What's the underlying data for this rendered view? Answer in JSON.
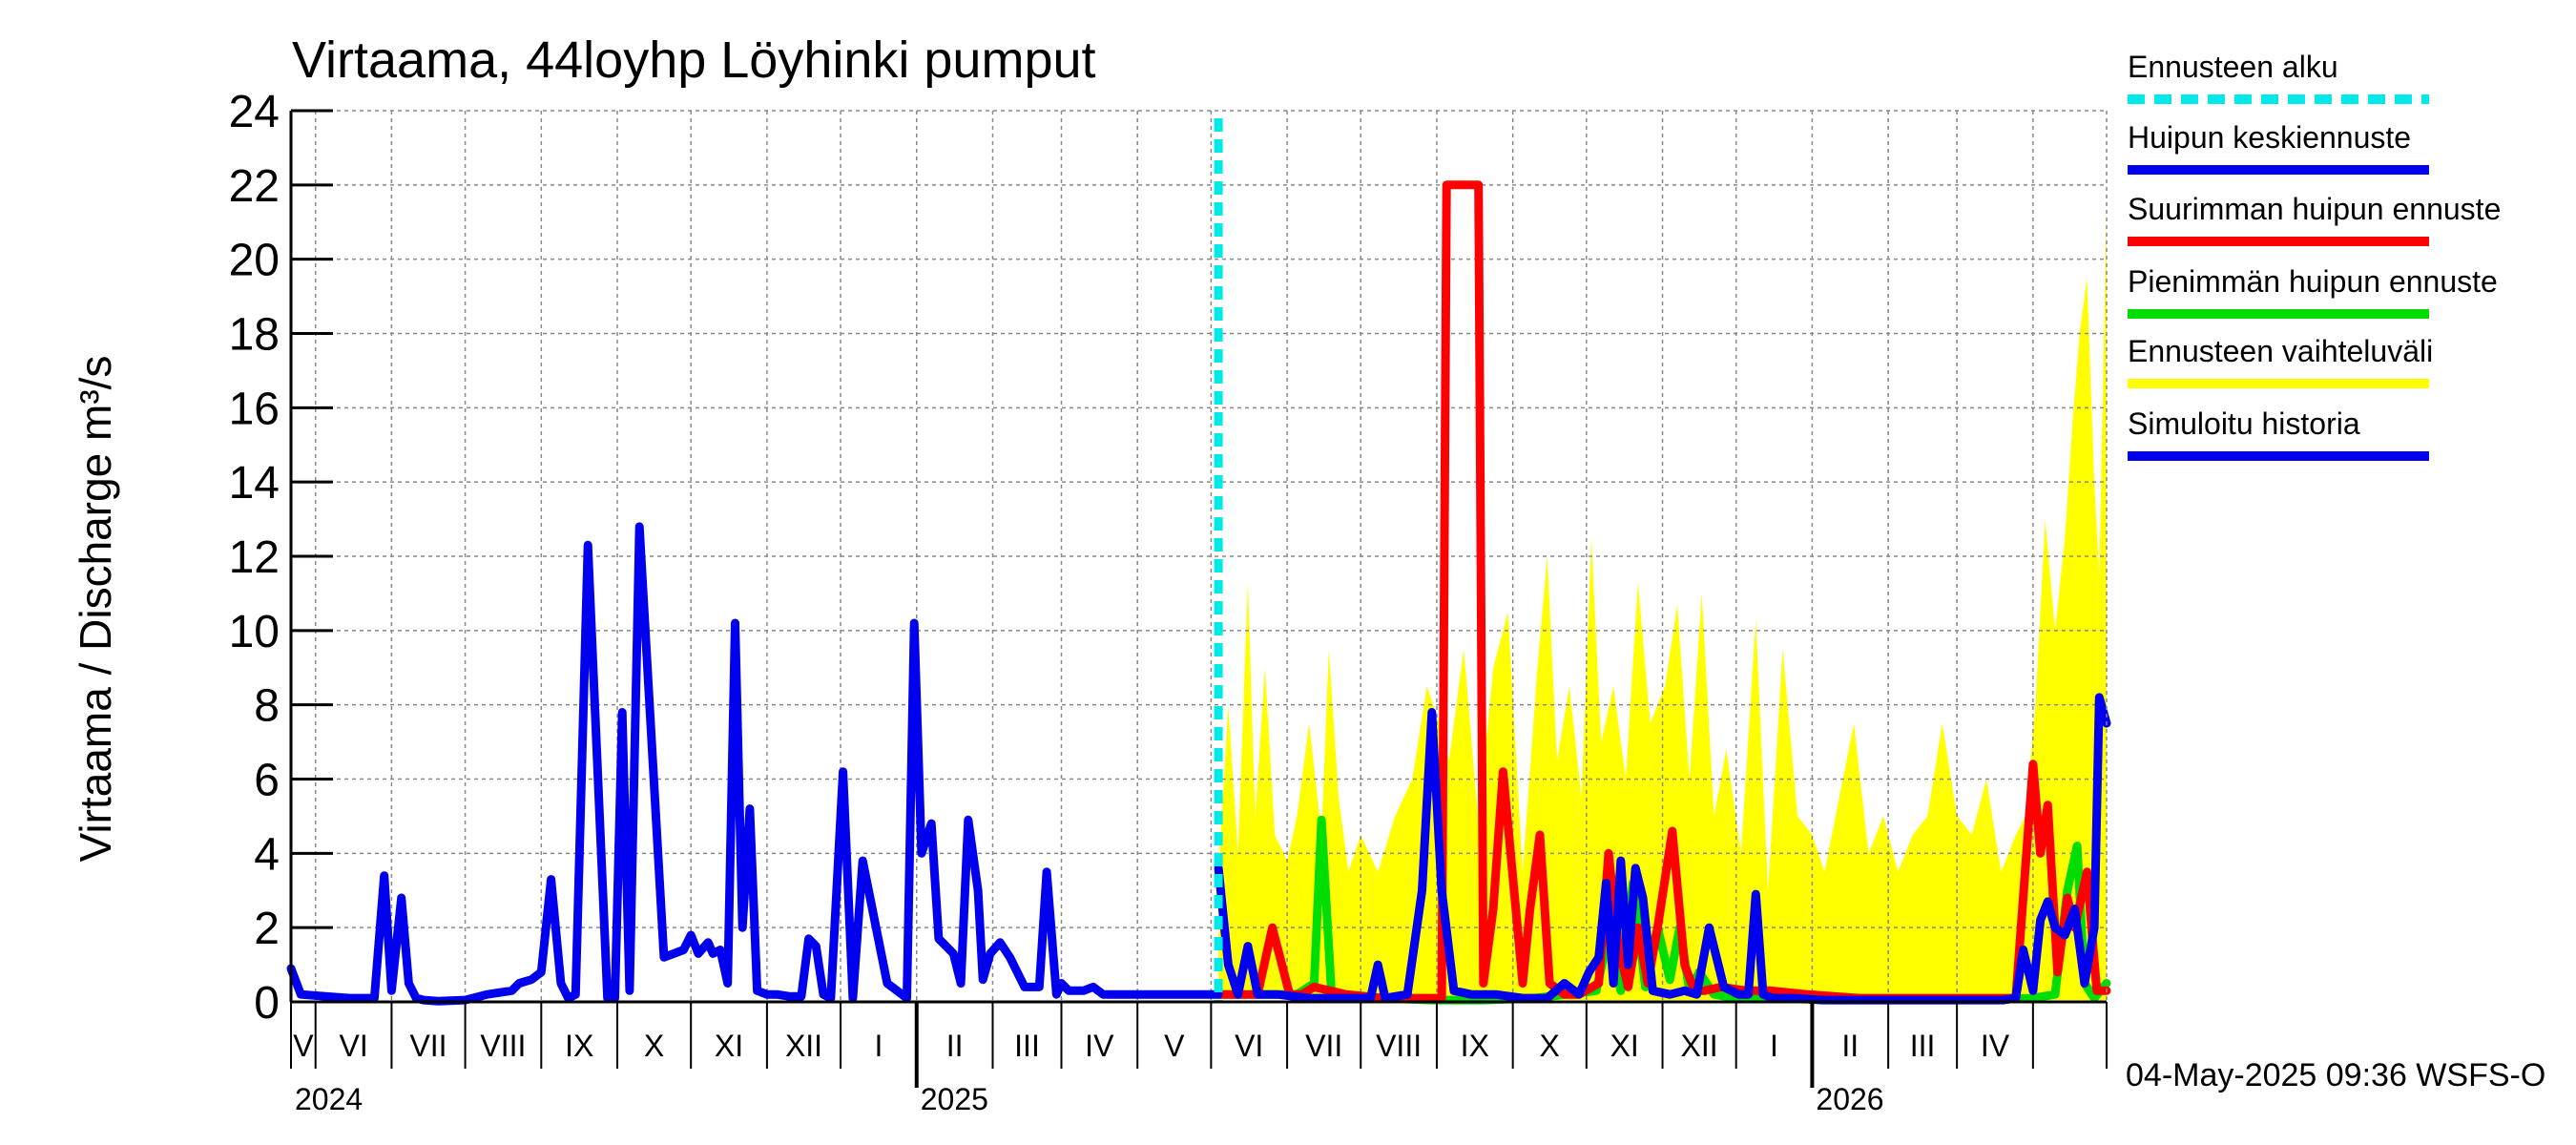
{
  "chart_data": {
    "type": "line",
    "title": "Virtaama, 44loyhp Löyhinki pumput",
    "ylabel": "Virtaama / Discharge    m³/s",
    "ylim": [
      0,
      24
    ],
    "yticks": [
      "0",
      "2",
      "4",
      "6",
      "8",
      "10",
      "12",
      "14",
      "16",
      "18",
      "20",
      "22",
      "24"
    ],
    "grid": true,
    "legend_placement": "right",
    "x_range": [
      "2024-04-21",
      "2026-05-01"
    ],
    "forecast_start": "2025-05-04",
    "months": [
      "V",
      "VI",
      "VII",
      "VIII",
      "IX",
      "X",
      "XI",
      "XII",
      "I",
      "II",
      "III",
      "IV",
      "V",
      "VI",
      "VII",
      "VIII",
      "IX",
      "X",
      "XI",
      "XII",
      "I",
      "II",
      "III",
      "IV"
    ],
    "years": [
      "2024",
      "2025",
      "2026"
    ],
    "timestamp": "04-May-2025 09:36 WSFS-O",
    "colors": {
      "forecast_start": "#00e8e8",
      "mean_peak": "#0000ee",
      "max_peak": "#ff0000",
      "min_peak": "#00dd00",
      "range": "#ffff00",
      "history": "#0000ee"
    },
    "legend": [
      {
        "label": "Ennusteen alku",
        "color": "#00e8e8",
        "dashed": true
      },
      {
        "label": "Huipun keskiennuste",
        "color": "#0000ee",
        "dashed": false
      },
      {
        "label": "Suurimman huipun ennuste",
        "color": "#ff0000",
        "dashed": false
      },
      {
        "label": "Pienimmän huipun ennuste",
        "color": "#00dd00",
        "dashed": false
      },
      {
        "label": "Ennusteen vaihteluväli",
        "color": "#ffff00",
        "dashed": false
      },
      {
        "label": "Simuloitu historia",
        "color": "#0000ee",
        "dashed": false
      }
    ],
    "series": [
      {
        "name": "Simuloitu historia",
        "x": [
          "2024-04-21",
          "2024-04-25",
          "2024-05-05",
          "2024-05-15",
          "2024-05-25",
          "2024-05-29",
          "2024-06-01",
          "2024-06-05",
          "2024-06-08",
          "2024-06-11",
          "2024-06-14",
          "2024-06-20",
          "2024-07-01",
          "2024-07-10",
          "2024-07-20",
          "2024-07-23",
          "2024-07-28",
          "2024-08-01",
          "2024-08-05",
          "2024-08-09",
          "2024-08-12",
          "2024-08-15",
          "2024-08-20",
          "2024-08-28",
          "2024-08-31",
          "2024-09-03",
          "2024-09-06",
          "2024-09-10",
          "2024-09-20",
          "2024-09-28",
          "2024-10-01",
          "2024-10-04",
          "2024-10-08",
          "2024-10-10",
          "2024-10-13",
          "2024-10-16",
          "2024-10-19",
          "2024-10-22",
          "2024-10-25",
          "2024-10-28",
          "2024-11-01",
          "2024-11-05",
          "2024-11-10",
          "2024-11-15",
          "2024-11-18",
          "2024-11-21",
          "2024-11-24",
          "2024-11-27",
          "2024-12-02",
          "2024-12-06",
          "2024-12-10",
          "2024-12-20",
          "2024-12-28",
          "2024-12-31",
          "2025-01-03",
          "2025-01-07",
          "2025-01-10",
          "2025-01-16",
          "2025-01-19",
          "2025-01-22",
          "2025-01-26",
          "2025-01-28",
          "2025-01-31",
          "2025-02-04",
          "2025-02-08",
          "2025-02-14",
          "2025-02-20",
          "2025-02-23",
          "2025-02-27",
          "2025-03-01",
          "2025-03-04",
          "2025-03-07",
          "2025-03-10",
          "2025-03-14",
          "2025-03-18",
          "2025-03-22",
          "2025-03-28",
          "2025-03-31",
          "2025-04-04",
          "2025-04-08",
          "2025-04-14",
          "2025-04-20",
          "2025-04-24",
          "2025-04-29",
          "2025-05-01",
          "2025-05-04"
        ],
        "values": [
          0.9,
          0.2,
          0.15,
          0.1,
          0.1,
          3.4,
          0.3,
          2.8,
          0.5,
          0.1,
          0.05,
          0.02,
          0.05,
          0.2,
          0.3,
          0.5,
          0.6,
          0.8,
          3.3,
          0.5,
          0.1,
          0.2,
          12.3,
          0.1,
          0.1,
          7.8,
          0.3,
          12.8,
          1.2,
          1.4,
          1.8,
          1.3,
          1.6,
          1.3,
          1.4,
          0.5,
          10.2,
          2.0,
          5.2,
          0.3,
          0.2,
          0.2,
          0.15,
          0.15,
          1.7,
          1.5,
          0.2,
          0.1,
          6.2,
          0.1,
          3.8,
          0.5,
          0.1,
          10.2,
          4.0,
          4.8,
          1.7,
          1.3,
          0.5,
          4.9,
          3.0,
          0.6,
          1.3,
          1.6,
          1.2,
          0.4,
          0.4,
          3.5,
          0.2,
          0.5,
          0.3,
          0.3,
          0.3,
          0.4,
          0.2,
          0.2,
          0.2,
          0.2,
          0.2,
          0.2,
          0.2,
          0.2,
          0.2,
          0.2,
          0.2,
          0.2
        ]
      },
      {
        "name": "Huipun keskiennuste",
        "x": [
          "2025-05-04",
          "2025-05-08",
          "2025-05-12",
          "2025-05-16",
          "2025-05-20",
          "2025-05-28",
          "2025-06-10",
          "2025-06-25",
          "2025-07-05",
          "2025-07-08",
          "2025-07-11",
          "2025-07-20",
          "2025-07-26",
          "2025-07-30",
          "2025-08-03",
          "2025-08-08",
          "2025-08-15",
          "2025-08-25",
          "2025-09-05",
          "2025-09-15",
          "2025-09-22",
          "2025-09-28",
          "2025-10-02",
          "2025-10-06",
          "2025-10-09",
          "2025-10-12",
          "2025-10-15",
          "2025-10-18",
          "2025-10-21",
          "2025-10-24",
          "2025-10-28",
          "2025-11-04",
          "2025-11-10",
          "2025-11-15",
          "2025-11-20",
          "2025-11-26",
          "2025-12-02",
          "2025-12-06",
          "2025-12-09",
          "2025-12-12",
          "2025-12-16",
          "2025-12-25",
          "2026-01-05",
          "2026-01-20",
          "2026-02-10",
          "2026-03-01",
          "2026-03-20",
          "2026-03-25",
          "2026-03-28",
          "2026-04-01",
          "2026-04-04",
          "2026-04-07",
          "2026-04-10",
          "2026-04-14",
          "2026-04-18",
          "2026-04-22",
          "2026-04-26",
          "2026-04-28",
          "2026-05-01"
        ],
        "values": [
          3.6,
          1.0,
          0.2,
          1.5,
          0.2,
          0.2,
          0.1,
          0.1,
          0.1,
          1.0,
          0.1,
          0.2,
          3.0,
          7.8,
          3.0,
          0.3,
          0.2,
          0.2,
          0.1,
          0.1,
          0.5,
          0.2,
          0.8,
          1.2,
          3.2,
          0.5,
          3.8,
          1.0,
          3.6,
          2.8,
          0.3,
          0.2,
          0.3,
          0.2,
          2.0,
          0.4,
          0.2,
          0.2,
          2.9,
          0.2,
          0.1,
          0.1,
          0.05,
          0.05,
          0.05,
          0.05,
          0.05,
          0.1,
          1.4,
          0.3,
          2.2,
          2.7,
          2.0,
          1.8,
          2.5,
          0.5,
          2.0,
          8.2,
          7.5
        ]
      },
      {
        "name": "Suurimman huipun ennuste",
        "x": [
          "2025-05-04",
          "2025-05-20",
          "2025-05-26",
          "2025-06-02",
          "2025-06-07",
          "2025-06-12",
          "2025-06-25",
          "2025-07-10",
          "2025-07-25",
          "2025-08-03",
          "2025-08-05",
          "2025-08-18",
          "2025-08-20",
          "2025-08-24",
          "2025-08-28",
          "2025-09-05",
          "2025-09-08",
          "2025-09-12",
          "2025-09-16",
          "2025-09-22",
          "2025-09-28",
          "2025-10-06",
          "2025-10-10",
          "2025-10-14",
          "2025-10-18",
          "2025-10-22",
          "2025-10-26",
          "2025-10-30",
          "2025-11-05",
          "2025-11-10",
          "2025-11-14",
          "2025-11-18",
          "2025-11-25",
          "2025-12-05",
          "2025-12-15",
          "2025-12-30",
          "2026-01-20",
          "2026-03-15",
          "2026-03-25",
          "2026-04-01",
          "2026-04-04",
          "2026-04-07",
          "2026-04-11",
          "2026-04-15",
          "2026-04-18",
          "2026-04-23",
          "2026-04-27",
          "2026-05-01"
        ],
        "values": [
          0.2,
          0.2,
          2.0,
          0.2,
          0.2,
          0.4,
          0.2,
          0.1,
          0.1,
          0.1,
          22.0,
          22.0,
          0.5,
          2.5,
          6.2,
          0.5,
          2.5,
          4.5,
          0.5,
          0.2,
          0.2,
          0.5,
          4.0,
          1.5,
          0.4,
          2.0,
          0.5,
          2.0,
          4.6,
          1.0,
          0.3,
          0.3,
          0.4,
          0.3,
          0.3,
          0.2,
          0.1,
          0.1,
          0.1,
          6.4,
          4.0,
          5.3,
          0.8,
          2.8,
          2.0,
          3.5,
          0.3,
          0.3
        ]
      },
      {
        "name": "Pienimmän huipun ennuste",
        "x": [
          "2025-05-04",
          "2025-06-05",
          "2025-06-12",
          "2025-06-15",
          "2025-06-19",
          "2025-06-25",
          "2025-07-10",
          "2025-07-30",
          "2025-08-20",
          "2025-09-10",
          "2025-10-05",
          "2025-10-10",
          "2025-10-15",
          "2025-10-20",
          "2025-10-25",
          "2025-10-30",
          "2025-11-04",
          "2025-11-08",
          "2025-11-12",
          "2025-11-16",
          "2025-11-22",
          "2025-12-01",
          "2025-12-15",
          "2026-01-10",
          "2026-03-01",
          "2026-04-01",
          "2026-04-10",
          "2026-04-15",
          "2026-04-19",
          "2026-04-22",
          "2026-04-26",
          "2026-05-01"
        ],
        "values": [
          0.2,
          0.2,
          0.5,
          4.9,
          0.3,
          0.2,
          0.1,
          0.05,
          0.05,
          0.1,
          0.3,
          1.8,
          0.3,
          3.2,
          0.4,
          2.0,
          0.6,
          2.0,
          0.3,
          0.8,
          0.2,
          0.1,
          0.1,
          0.05,
          0.05,
          0.1,
          0.2,
          3.0,
          4.2,
          0.5,
          0.1,
          0.5
        ]
      }
    ],
    "range_band": {
      "x": [
        "2025-05-04",
        "2025-05-08",
        "2025-05-12",
        "2025-05-16",
        "2025-05-19",
        "2025-05-23",
        "2025-05-27",
        "2025-06-01",
        "2025-06-05",
        "2025-06-10",
        "2025-06-15",
        "2025-06-18",
        "2025-06-22",
        "2025-06-26",
        "2025-07-01",
        "2025-07-08",
        "2025-07-15",
        "2025-07-22",
        "2025-07-28",
        "2025-08-02",
        "2025-08-06",
        "2025-08-12",
        "2025-08-18",
        "2025-08-24",
        "2025-08-30",
        "2025-09-05",
        "2025-09-11",
        "2025-09-15",
        "2025-09-19",
        "2025-09-24",
        "2025-09-29",
        "2025-10-03",
        "2025-10-07",
        "2025-10-12",
        "2025-10-17",
        "2025-10-22",
        "2025-10-27",
        "2025-11-02",
        "2025-11-07",
        "2025-11-12",
        "2025-11-17",
        "2025-11-22",
        "2025-11-27",
        "2025-12-03",
        "2025-12-09",
        "2025-12-14",
        "2025-12-20",
        "2025-12-26",
        "2026-01-01",
        "2026-01-06",
        "2026-01-12",
        "2026-01-18",
        "2026-01-24",
        "2026-01-30",
        "2026-02-05",
        "2026-02-11",
        "2026-02-17",
        "2026-02-23",
        "2026-03-01",
        "2026-03-07",
        "2026-03-13",
        "2026-03-19",
        "2026-03-25",
        "2026-03-29",
        "2026-04-02",
        "2026-04-06",
        "2026-04-10",
        "2026-04-14",
        "2026-04-17",
        "2026-04-20",
        "2026-04-23",
        "2026-04-26",
        "2026-04-28",
        "2026-05-01"
      ],
      "upper": [
        3.5,
        8.0,
        4.0,
        11.3,
        5.0,
        9.0,
        4.5,
        3.8,
        5.0,
        7.5,
        4.5,
        9.5,
        5.5,
        3.5,
        4.5,
        3.5,
        5.0,
        6.0,
        8.5,
        7.5,
        6.5,
        9.5,
        4.8,
        9.0,
        10.5,
        3.5,
        9.0,
        12.0,
        6.5,
        8.5,
        5.5,
        12.5,
        7.0,
        8.5,
        6.0,
        11.3,
        7.5,
        8.5,
        10.7,
        6.0,
        11.0,
        5.0,
        6.8,
        4.0,
        10.3,
        3.0,
        9.5,
        5.0,
        4.5,
        3.5,
        5.5,
        7.5,
        4.0,
        5.0,
        3.5,
        4.5,
        5.0,
        7.5,
        5.0,
        4.5,
        6.0,
        3.5,
        4.5,
        5.0,
        8.0,
        13.0,
        10.0,
        12.5,
        15.5,
        18.0,
        19.5,
        14.0,
        11.5,
        21.5
      ],
      "lower": [
        0.1,
        0.1,
        0.1,
        0.1,
        0.1,
        0.1,
        0.1,
        0.1,
        0.1,
        0.1,
        0.1,
        0.1,
        0.1,
        0.1,
        0.05,
        0.05,
        0.05,
        0.05,
        0.05,
        0.05,
        0.05,
        0.05,
        0.05,
        0.05,
        0.05,
        0.05,
        0.05,
        0.05,
        0.05,
        0.05,
        0.05,
        0.05,
        0.05,
        0.05,
        0.05,
        0.05,
        0.05,
        0.05,
        0.05,
        0.05,
        0.05,
        0.05,
        0.05,
        0.05,
        0.05,
        0.05,
        0.05,
        0.05,
        0.05,
        0.05,
        0.05,
        0.05,
        0.05,
        0.05,
        0.05,
        0.05,
        0.05,
        0.05,
        0.05,
        0.05,
        0.05,
        0.05,
        0.05,
        0.05,
        0.05,
        0.05,
        0.05,
        0.05,
        0.05,
        0.05,
        0.05,
        0.05,
        0.05,
        0.05
      ]
    }
  }
}
